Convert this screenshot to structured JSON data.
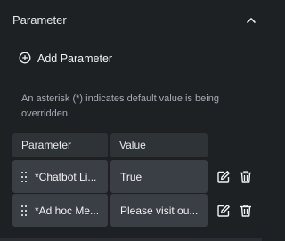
{
  "section": {
    "title": "Parameter",
    "collapse_icon": "chevron-up-icon"
  },
  "add_button": {
    "label": "Add Parameter",
    "icon": "plus-circle-icon"
  },
  "note": "An asterisk (*) indicates default value is being overridden",
  "table": {
    "columns": [
      "Parameter",
      "Value"
    ],
    "rows": [
      {
        "parameter": "*Chatbot Li...",
        "value": "True"
      },
      {
        "parameter": "*Ad hoc Me...",
        "value": "Please visit ou..."
      }
    ],
    "row_icons": [
      "drag-handle-icon",
      "edit-icon",
      "delete-icon"
    ]
  },
  "colors": {
    "background": "#1e2124",
    "header_cell": "#2e3338",
    "row_cell": "#3a3f45",
    "text": "#f0f2f4",
    "muted_text": "#a6acb3"
  }
}
